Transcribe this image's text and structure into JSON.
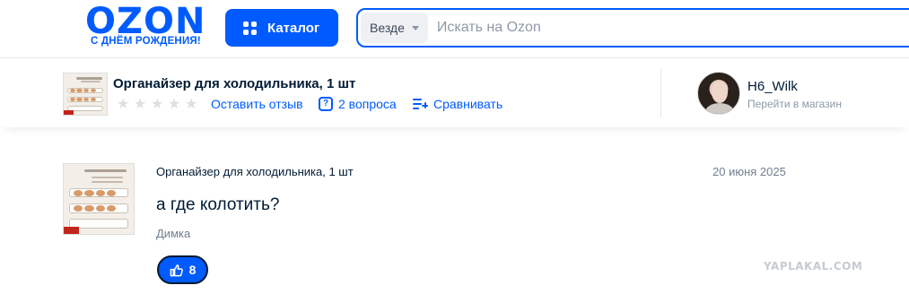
{
  "header": {
    "logo_word": "OZON",
    "logo_subtitle": "С ДНЁМ РОЖДЕНИЯ!",
    "catalog_label": "Каталог",
    "search_scope": "Везде",
    "search_placeholder": "Искать на Ozon",
    "search_value": ""
  },
  "product_bar": {
    "title": "Органайзер для холодильника, 1 шт",
    "rating_stars": 5,
    "rating_value": 0,
    "review_link": "Оставить отзыв",
    "questions_link": "2 вопроса",
    "compare_link": "Сравнивать",
    "seller_name": "H6_Wilk",
    "seller_link": "Перейти в магазин"
  },
  "question": {
    "product_name": "Органайзер для холодильника, 1 шт",
    "date": "20 июня 2025",
    "text": "а где колотить?",
    "author": "Димка",
    "likes": "8"
  },
  "watermark": "YAPLAKAL.COM",
  "colors": {
    "brand": "#005bff",
    "text": "#001a34",
    "muted": "#707f8d"
  },
  "icons": {
    "catalog": "grid-icon",
    "search_scope": "caret-down-icon",
    "questions": "question-bubble-icon",
    "compare": "compare-list-icon",
    "like": "thumbs-up-icon",
    "rating": "star-icon"
  }
}
